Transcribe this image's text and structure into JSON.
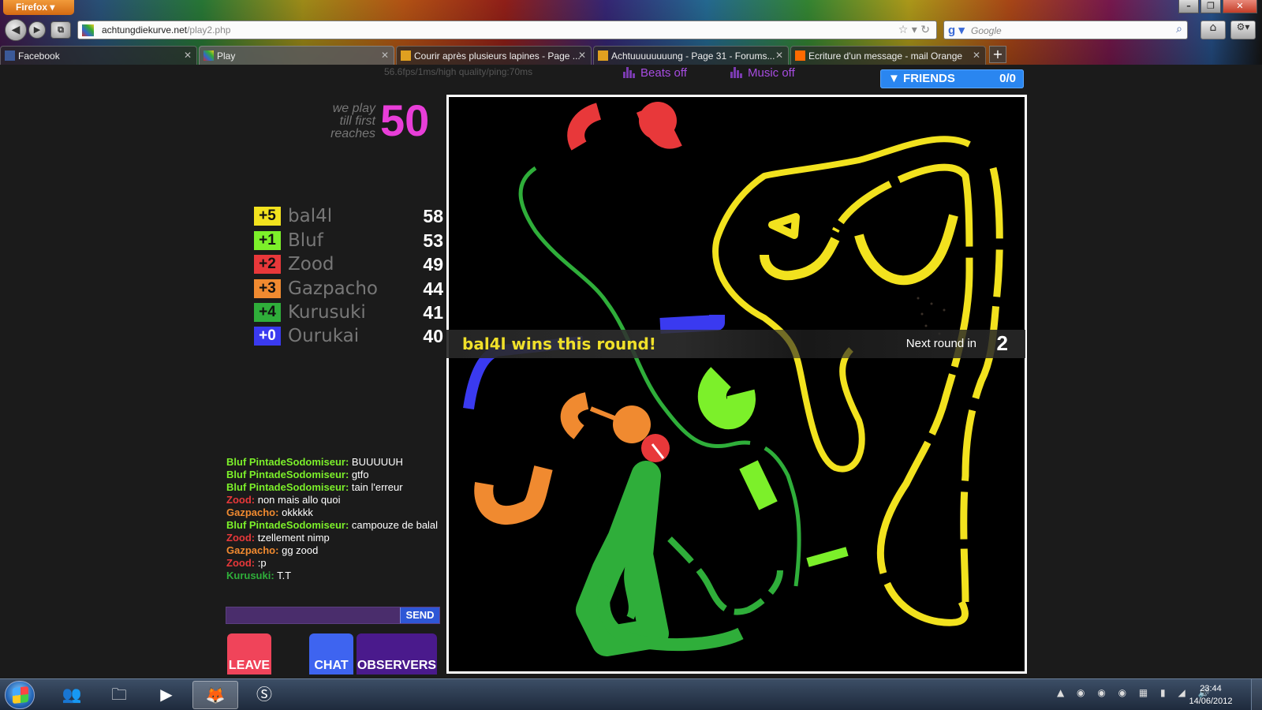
{
  "browser": {
    "menu_label": "Firefox",
    "url_domain": "achtungdiekurve.net",
    "url_path": "/play2.php",
    "search_placeholder": "Google",
    "tabs": [
      {
        "label": "Facebook",
        "fav_color": "#3b5998"
      },
      {
        "label": "Play",
        "fav_color": "#7a3bd0"
      },
      {
        "label": "Courir après plusieurs lapines - Page ...",
        "fav_color": "#e0a020"
      },
      {
        "label": "Achtuuuuuuuung - Page 31 - Forums...",
        "fav_color": "#e0a020"
      },
      {
        "label": "Ecriture d'un message - mail Orange",
        "fav_color": "#ff6a00"
      }
    ],
    "new_tab_label": "+"
  },
  "game": {
    "stats": "56.6fps/1ms/high quality/ping:70ms",
    "beats_label": "Beats off",
    "music_label": "Music off",
    "friends_label": "FRIENDS",
    "friends_count": "0/0",
    "goal_text": "we play till first reaches",
    "goal_value": "50",
    "scores": [
      {
        "delta": "+5",
        "name": "bal4l",
        "score": "58",
        "color": "#f2e21e"
      },
      {
        "delta": "+1",
        "name": "Bluf",
        "score": "53",
        "color": "#7cf02a"
      },
      {
        "delta": "+2",
        "name": "Zood",
        "score": "49",
        "color": "#e8383a"
      },
      {
        "delta": "+3",
        "name": "Gazpacho",
        "score": "44",
        "color": "#f08a30"
      },
      {
        "delta": "+4",
        "name": "Kurusuki",
        "score": "41",
        "color": "#2fae3a"
      },
      {
        "delta": "+0",
        "name": "Ourukai",
        "score": "40",
        "color": "#3a3af0"
      }
    ],
    "chat": [
      {
        "who": "Bluf PintadeSodomiseur:",
        "text": "BUUUUUH",
        "color": "#7cf02a"
      },
      {
        "who": "Bluf PintadeSodomiseur:",
        "text": "gtfo",
        "color": "#7cf02a"
      },
      {
        "who": "Bluf PintadeSodomiseur:",
        "text": "tain l'erreur",
        "color": "#7cf02a"
      },
      {
        "who": "Zood:",
        "text": "non mais allo quoi",
        "color": "#e8383a"
      },
      {
        "who": "Gazpacho:",
        "text": "okkkkk",
        "color": "#f08a30"
      },
      {
        "who": "Bluf PintadeSodomiseur:",
        "text": "campouze de balal",
        "color": "#7cf02a"
      },
      {
        "who": "Zood:",
        "text": "tzellement nimp",
        "color": "#e8383a"
      },
      {
        "who": "Gazpacho:",
        "text": "gg zood",
        "color": "#f08a30"
      },
      {
        "who": "Zood:",
        "text": ":p",
        "color": "#e8383a"
      },
      {
        "who": "Kurusuki:",
        "text": "T.T",
        "color": "#2fae3a"
      }
    ],
    "chat_input_value": "",
    "send_label": "SEND",
    "leave_label": "LEAVE",
    "chat_label": "CHAT",
    "observers_label": "OBSERVERS",
    "win_message": "bal4l wins this round!",
    "next_round_label": "Next round in",
    "next_round_value": "2"
  },
  "taskbar": {
    "time": "23:44",
    "date": "14/06/2012"
  },
  "colors": {
    "yellow": "#f2e21e",
    "lime": "#7cf02a",
    "red": "#e8383a",
    "orange": "#f08a30",
    "green": "#2fae3a",
    "blue": "#3a3af0",
    "goal": "#e83ed8"
  }
}
